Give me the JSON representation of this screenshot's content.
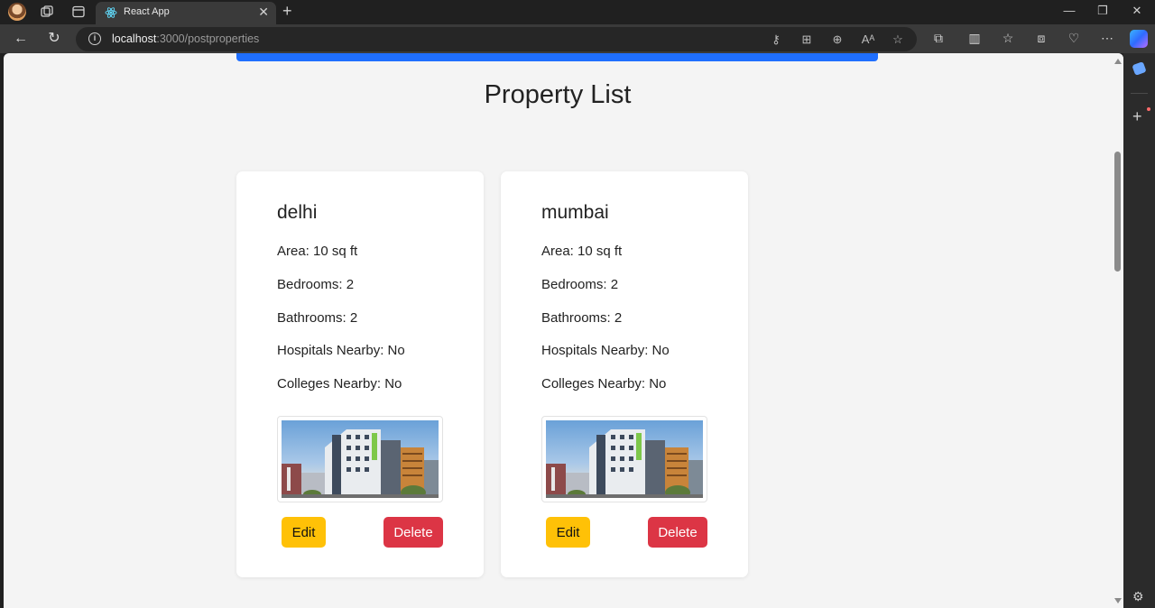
{
  "browser": {
    "tab_title": "React App",
    "url_host": "localhost",
    "url_rest": ":3000/postproperties"
  },
  "page": {
    "title": "Property List"
  },
  "properties": [
    {
      "name": "delhi",
      "area": "Area: 10 sq ft",
      "bedrooms": "Bedrooms: 2",
      "bathrooms": "Bathrooms: 2",
      "hospitals": "Hospitals Nearby: No",
      "colleges": "Colleges Nearby: No",
      "image_icon": "building-photo",
      "edit_label": "Edit",
      "delete_label": "Delete"
    },
    {
      "name": "mumbai",
      "area": "Area: 10 sq ft",
      "bedrooms": "Bedrooms: 2",
      "bathrooms": "Bathrooms: 2",
      "hospitals": "Hospitals Nearby: No",
      "colleges": "Colleges Nearby: No",
      "image_icon": "building-photo",
      "edit_label": "Edit",
      "delete_label": "Delete"
    }
  ],
  "colors": {
    "accent_bar": "#1f6fff",
    "edit_button": "#ffc107",
    "delete_button": "#dc3545",
    "page_bg": "#f4f4f4"
  }
}
